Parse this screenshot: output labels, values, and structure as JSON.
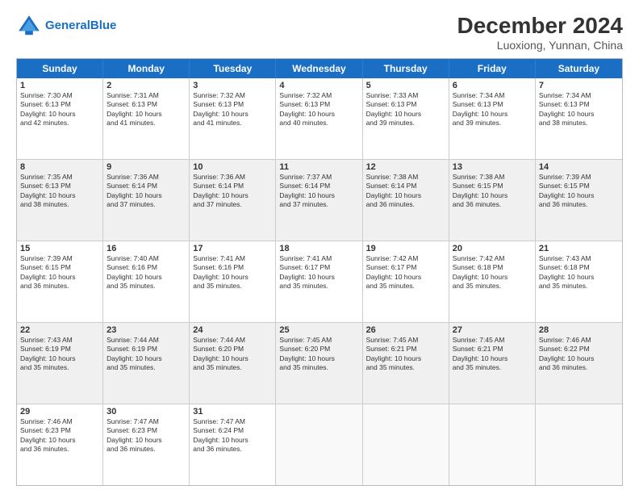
{
  "header": {
    "logo_general": "General",
    "logo_blue": "Blue",
    "main_title": "December 2024",
    "subtitle": "Luoxiong, Yunnan, China"
  },
  "weekdays": [
    "Sunday",
    "Monday",
    "Tuesday",
    "Wednesday",
    "Thursday",
    "Friday",
    "Saturday"
  ],
  "rows": [
    [
      {
        "day": "1",
        "info": "Sunrise: 7:30 AM\nSunset: 6:13 PM\nDaylight: 10 hours\nand 42 minutes."
      },
      {
        "day": "2",
        "info": "Sunrise: 7:31 AM\nSunset: 6:13 PM\nDaylight: 10 hours\nand 41 minutes."
      },
      {
        "day": "3",
        "info": "Sunrise: 7:32 AM\nSunset: 6:13 PM\nDaylight: 10 hours\nand 41 minutes."
      },
      {
        "day": "4",
        "info": "Sunrise: 7:32 AM\nSunset: 6:13 PM\nDaylight: 10 hours\nand 40 minutes."
      },
      {
        "day": "5",
        "info": "Sunrise: 7:33 AM\nSunset: 6:13 PM\nDaylight: 10 hours\nand 39 minutes."
      },
      {
        "day": "6",
        "info": "Sunrise: 7:34 AM\nSunset: 6:13 PM\nDaylight: 10 hours\nand 39 minutes."
      },
      {
        "day": "7",
        "info": "Sunrise: 7:34 AM\nSunset: 6:13 PM\nDaylight: 10 hours\nand 38 minutes."
      }
    ],
    [
      {
        "day": "8",
        "info": "Sunrise: 7:35 AM\nSunset: 6:13 PM\nDaylight: 10 hours\nand 38 minutes."
      },
      {
        "day": "9",
        "info": "Sunrise: 7:36 AM\nSunset: 6:14 PM\nDaylight: 10 hours\nand 37 minutes."
      },
      {
        "day": "10",
        "info": "Sunrise: 7:36 AM\nSunset: 6:14 PM\nDaylight: 10 hours\nand 37 minutes."
      },
      {
        "day": "11",
        "info": "Sunrise: 7:37 AM\nSunset: 6:14 PM\nDaylight: 10 hours\nand 37 minutes."
      },
      {
        "day": "12",
        "info": "Sunrise: 7:38 AM\nSunset: 6:14 PM\nDaylight: 10 hours\nand 36 minutes."
      },
      {
        "day": "13",
        "info": "Sunrise: 7:38 AM\nSunset: 6:15 PM\nDaylight: 10 hours\nand 36 minutes."
      },
      {
        "day": "14",
        "info": "Sunrise: 7:39 AM\nSunset: 6:15 PM\nDaylight: 10 hours\nand 36 minutes."
      }
    ],
    [
      {
        "day": "15",
        "info": "Sunrise: 7:39 AM\nSunset: 6:15 PM\nDaylight: 10 hours\nand 36 minutes."
      },
      {
        "day": "16",
        "info": "Sunrise: 7:40 AM\nSunset: 6:16 PM\nDaylight: 10 hours\nand 35 minutes."
      },
      {
        "day": "17",
        "info": "Sunrise: 7:41 AM\nSunset: 6:16 PM\nDaylight: 10 hours\nand 35 minutes."
      },
      {
        "day": "18",
        "info": "Sunrise: 7:41 AM\nSunset: 6:17 PM\nDaylight: 10 hours\nand 35 minutes."
      },
      {
        "day": "19",
        "info": "Sunrise: 7:42 AM\nSunset: 6:17 PM\nDaylight: 10 hours\nand 35 minutes."
      },
      {
        "day": "20",
        "info": "Sunrise: 7:42 AM\nSunset: 6:18 PM\nDaylight: 10 hours\nand 35 minutes."
      },
      {
        "day": "21",
        "info": "Sunrise: 7:43 AM\nSunset: 6:18 PM\nDaylight: 10 hours\nand 35 minutes."
      }
    ],
    [
      {
        "day": "22",
        "info": "Sunrise: 7:43 AM\nSunset: 6:19 PM\nDaylight: 10 hours\nand 35 minutes."
      },
      {
        "day": "23",
        "info": "Sunrise: 7:44 AM\nSunset: 6:19 PM\nDaylight: 10 hours\nand 35 minutes."
      },
      {
        "day": "24",
        "info": "Sunrise: 7:44 AM\nSunset: 6:20 PM\nDaylight: 10 hours\nand 35 minutes."
      },
      {
        "day": "25",
        "info": "Sunrise: 7:45 AM\nSunset: 6:20 PM\nDaylight: 10 hours\nand 35 minutes."
      },
      {
        "day": "26",
        "info": "Sunrise: 7:45 AM\nSunset: 6:21 PM\nDaylight: 10 hours\nand 35 minutes."
      },
      {
        "day": "27",
        "info": "Sunrise: 7:45 AM\nSunset: 6:21 PM\nDaylight: 10 hours\nand 35 minutes."
      },
      {
        "day": "28",
        "info": "Sunrise: 7:46 AM\nSunset: 6:22 PM\nDaylight: 10 hours\nand 36 minutes."
      }
    ],
    [
      {
        "day": "29",
        "info": "Sunrise: 7:46 AM\nSunset: 6:23 PM\nDaylight: 10 hours\nand 36 minutes."
      },
      {
        "day": "30",
        "info": "Sunrise: 7:47 AM\nSunset: 6:23 PM\nDaylight: 10 hours\nand 36 minutes."
      },
      {
        "day": "31",
        "info": "Sunrise: 7:47 AM\nSunset: 6:24 PM\nDaylight: 10 hours\nand 36 minutes."
      },
      {
        "day": "",
        "info": ""
      },
      {
        "day": "",
        "info": ""
      },
      {
        "day": "",
        "info": ""
      },
      {
        "day": "",
        "info": ""
      }
    ]
  ]
}
